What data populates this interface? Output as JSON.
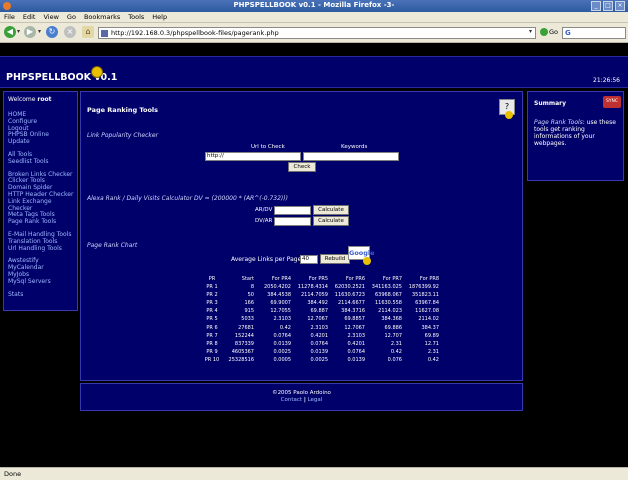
{
  "window": {
    "title": "PHPSPELLBOOK v0.1 - Mozilla Firefox -3-"
  },
  "menu": [
    "File",
    "Edit",
    "View",
    "Go",
    "Bookmarks",
    "Tools",
    "Help"
  ],
  "nav": {
    "url": "http://192.168.0.3/phpspellbook-files/pagerank.php",
    "go_label": "Go",
    "search_engine": "G"
  },
  "header": {
    "logo": "PHPSPELLBOOK v0.1",
    "clock": "21:26:56"
  },
  "sidebar": {
    "welcome_prefix": "Welcome",
    "user": "root",
    "groups": [
      [
        "HOME",
        "Configure",
        "Logout",
        "PHPSB Online",
        "Update"
      ],
      [
        "All Tools",
        "Seedlist Tools"
      ],
      [
        "Broken Links Checker",
        "Clicker Tools",
        "Domain Spider",
        "HTTP Header Checker",
        "Link Exchange",
        "Checker",
        "Meta Tags Tools",
        "Page Rank Tools"
      ],
      [
        "E-Mail Handling Tools",
        "Translation Tools",
        "Url Handling Tools"
      ],
      [
        "Awstestify",
        "MyCalendar",
        "MyJobs",
        "MySql Servers"
      ],
      [
        "Stats"
      ]
    ]
  },
  "main": {
    "title": "Page Ranking Tools",
    "help_icon": "?",
    "link_pop": {
      "heading": "Link Popularity Checker",
      "url_label": "Url to Check",
      "keywords_label": "Keywords",
      "url_value": "http://",
      "button": "Check"
    },
    "alexa": {
      "heading": "Alexa Rank / Daily Visits Calculator  DV = (200000 * (AR^(-0.732)))",
      "ar_label": "AR/DV",
      "dv_label": "DV/AR",
      "button": "Calculate"
    },
    "chart": {
      "heading": "Page Rank Chart",
      "avg_label": "Average Links per Page",
      "avg_value": "40",
      "rebuild": "Rebuild",
      "google": "Google",
      "headers": [
        "PR",
        "Start",
        "For PR4",
        "For PR5",
        "For PR6",
        "For PR7",
        "For PR8"
      ],
      "rows": [
        [
          "PR 1",
          "8",
          "2050.4202",
          "11278.4314",
          "62030.2521",
          "341163.025",
          "1876399.92"
        ],
        [
          "PR 2",
          "50",
          "384.4538",
          "2114.7059",
          "11630.6723",
          "63968.067",
          "351823.11"
        ],
        [
          "PR 3",
          "166",
          "69.9007",
          "384.492",
          "2114.6677",
          "11630.558",
          "63967.84"
        ],
        [
          "PR 4",
          "915",
          "12.7055",
          "69.887",
          "384.3716",
          "2114.023",
          "11627.08"
        ],
        [
          "PR 5",
          "5033",
          "2.3103",
          "12.7067",
          "69.8857",
          "384.368",
          "2114.02"
        ],
        [
          "PR 6",
          "27681",
          "0.42",
          "2.3103",
          "12.7067",
          "69.886",
          "384.37"
        ],
        [
          "PR 7",
          "152244",
          "0.0764",
          "0.4201",
          "2.3103",
          "12.707",
          "69.89"
        ],
        [
          "PR 8",
          "837339",
          "0.0139",
          "0.0764",
          "0.4201",
          "2.31",
          "12.71"
        ],
        [
          "PR 9",
          "4605367",
          "0.0025",
          "0.0139",
          "0.0764",
          "0.42",
          "2.31"
        ],
        [
          "PR 10",
          "25328516",
          "0.0005",
          "0.0025",
          "0.0139",
          "0.076",
          "0.42"
        ]
      ]
    }
  },
  "summary": {
    "title": "Summary",
    "icon_text": "SYNC",
    "tool_name": "Page Rank Tools",
    "text": ": use these tools get ranking informations of your webpages."
  },
  "footer": {
    "copyright": "©2005 Paolo Ardoino",
    "contact": "Contact",
    "separator": "|",
    "legal": "Legal"
  },
  "status": "Done"
}
